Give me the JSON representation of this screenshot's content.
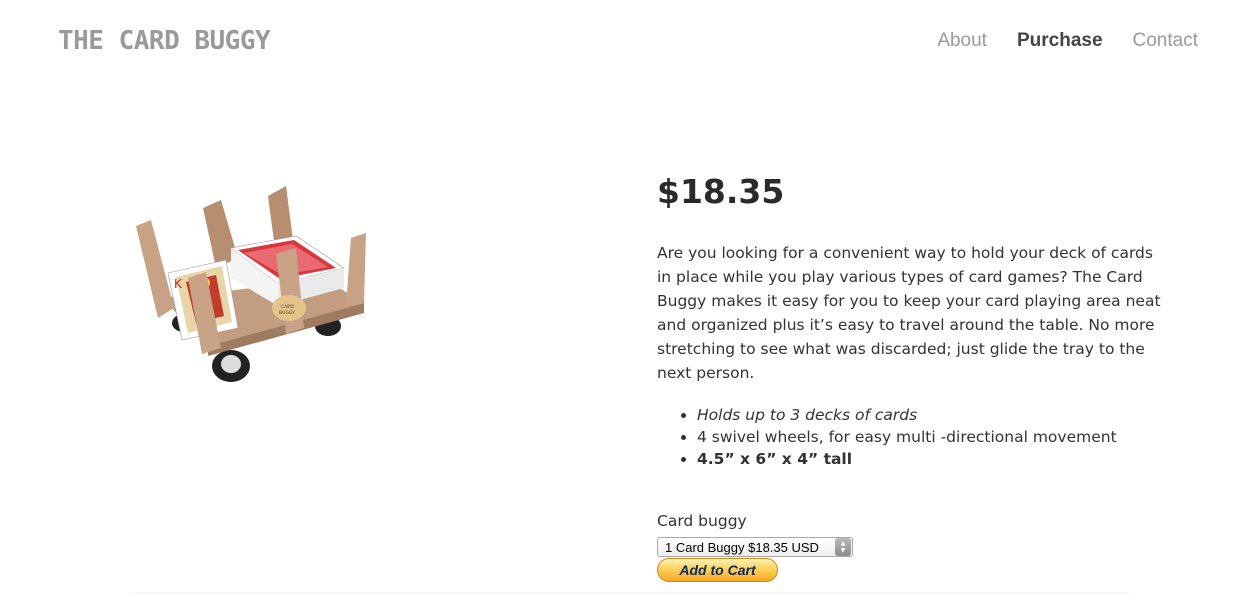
{
  "header": {
    "logo": "THE CARD BUGGY",
    "nav": [
      "About",
      "Purchase",
      "Contact"
    ],
    "active_nav": "Purchase"
  },
  "product": {
    "price": "$18.35",
    "description": "Are you looking for a convenient way to hold your deck of cards in place while you play various types of card games? The Card Buggy makes it easy for you to keep your card playing area neat and organized plus it’s easy to travel around the table. No more stretching to see what was discarded; just glide the tray to the next person.",
    "features": [
      "Holds up to 3 decks of cards",
      "4 swivel wheels, for easy multi -directional movement",
      "4.5” x 6” x 4” tall"
    ],
    "image_label": "CARD BUGGY"
  },
  "purchase": {
    "option_label": "Card buggy",
    "selected_option": "1 Card Buggy $18.35 USD",
    "add_to_cart": "Add to Cart"
  }
}
